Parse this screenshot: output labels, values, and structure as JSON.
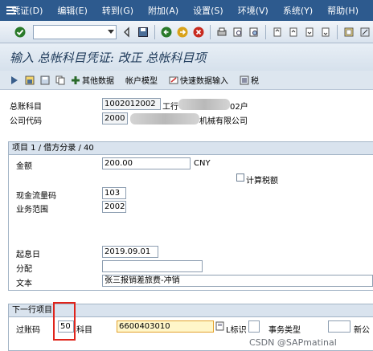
{
  "menu": {
    "items": [
      "凭证(D)",
      "编辑(E)",
      "转到(G)",
      "附加(A)",
      "设置(S)",
      "环境(V)",
      "系统(Y)",
      "帮助(H)"
    ]
  },
  "toolbar": {
    "command_field": ""
  },
  "title": "输入 总帐科目凭证: 改正 总帐科目项",
  "app_toolbar": {
    "other_data": "其他数据",
    "account_model": "帐户模型",
    "fast_entry": "快速数据输入",
    "tax": "税"
  },
  "header": {
    "gl_account_label": "总账科目",
    "gl_account_value": "1002012002",
    "gl_account_desc_start": "工行",
    "gl_account_desc_end": "02户",
    "company_code_label": "公司代码",
    "company_code_value": "2000",
    "company_name_end": "机械有限公司"
  },
  "item": {
    "group_title": "项目 1 / 借方分录 / 40",
    "amount_label": "金额",
    "amount_value": "200.00",
    "currency": "CNY",
    "calc_tax_label": "计算税额",
    "calc_tax_checked": false,
    "cashflow_label": "现金流量码",
    "cashflow_value": "103",
    "business_area_label": "业务范围",
    "business_area_value": "2002",
    "value_date_label": "起息日",
    "value_date_value": "2019.09.01",
    "assignment_label": "分配",
    "assignment_value": "",
    "text_label": "文本",
    "text_value": "张三报销差旅费-冲销"
  },
  "next_item": {
    "group_title": "下一行项目",
    "posting_key_label": "过账码",
    "posting_key_value": "50",
    "account_label": "科目",
    "account_value": "6600403010",
    "sgl_label": "L标识",
    "trans_type_label": "事务类型",
    "new_company_label": "新公"
  },
  "watermark": "CSDN @SAPmatinal"
}
